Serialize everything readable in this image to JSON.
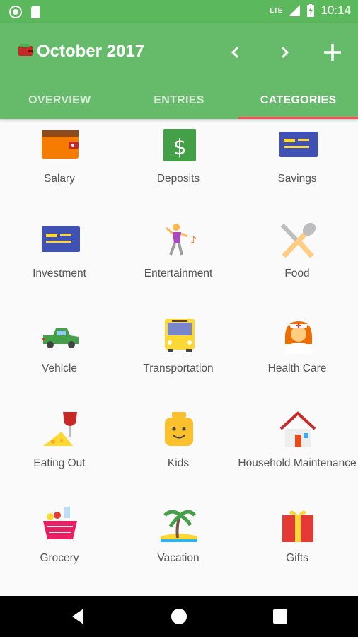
{
  "status_bar": {
    "time": "10:14",
    "network": "LTE"
  },
  "app_bar": {
    "title": "October 2017",
    "icons": {
      "logo": "wallet-logo-icon",
      "prev": "chevron-left-icon",
      "next": "chevron-right-icon",
      "add": "plus-icon"
    }
  },
  "tabs": [
    {
      "label": "OVERVIEW",
      "active": false
    },
    {
      "label": "ENTRIES",
      "active": false
    },
    {
      "label": "CATEGORIES",
      "active": true
    }
  ],
  "categories": [
    {
      "label": "Salary",
      "icon": "wallet-icon"
    },
    {
      "label": "Deposits",
      "icon": "dollar-icon"
    },
    {
      "label": "Savings",
      "icon": "card-icon"
    },
    {
      "label": "Investment",
      "icon": "card-icon"
    },
    {
      "label": "Entertainment",
      "icon": "dancer-icon"
    },
    {
      "label": "Food",
      "icon": "utensils-icon"
    },
    {
      "label": "Vehicle",
      "icon": "car-icon"
    },
    {
      "label": "Transportation",
      "icon": "bus-icon"
    },
    {
      "label": "Health Care",
      "icon": "nurse-icon"
    },
    {
      "label": "Eating Out",
      "icon": "wine-cheese-icon"
    },
    {
      "label": "Kids",
      "icon": "toy-icon"
    },
    {
      "label": "Household Maintenance",
      "icon": "house-icon"
    },
    {
      "label": "Grocery",
      "icon": "basket-icon"
    },
    {
      "label": "Vacation",
      "icon": "palm-tree-icon"
    },
    {
      "label": "Gifts",
      "icon": "gift-icon"
    }
  ],
  "colors": {
    "primary": "#66bb6a",
    "status_bar": "#5cb85c",
    "tab_indicator": "#ef5350",
    "label": "#555555"
  }
}
